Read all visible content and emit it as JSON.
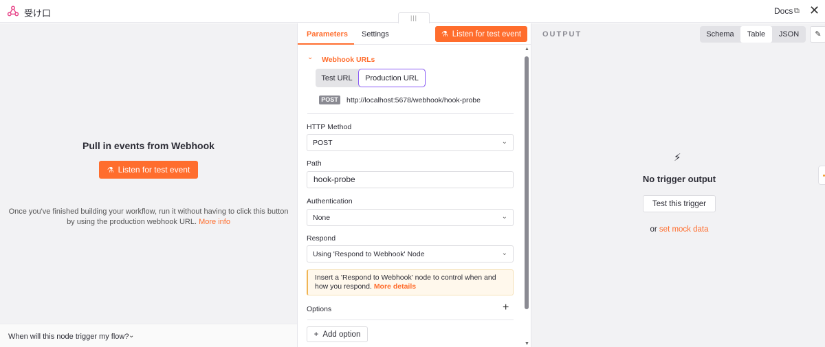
{
  "titlebar": {
    "title": "受け口",
    "docs_label": "Docs",
    "accent": "#ff6d2d"
  },
  "left_panel": {
    "heading": "Pull in events from Webhook",
    "listen_button": "Listen for test event",
    "note": "Once you've finished building your workflow, run it without having to click this button by using the production webhook URL.",
    "more_info": "More info",
    "footer_question": "When will this node trigger my flow?"
  },
  "params": {
    "tabs": [
      "Parameters",
      "Settings"
    ],
    "listen_button": "Listen for test event",
    "webhook_urls": {
      "title": "Webhook URLs",
      "options": [
        "Test URL",
        "Production URL"
      ],
      "selected": "Production URL",
      "method_badge": "POST",
      "url": "http://localhost:5678/webhook/hook-probe"
    },
    "http_method": {
      "label": "HTTP Method",
      "value": "POST"
    },
    "path": {
      "label": "Path",
      "value": "hook-probe"
    },
    "authentication": {
      "label": "Authentication",
      "value": "None"
    },
    "respond": {
      "label": "Respond",
      "value": "Using 'Respond to Webhook' Node"
    },
    "notice": {
      "text": "Insert a 'Respond to Webhook' node to control when and how you respond.",
      "link": "More details"
    },
    "options_label": "Options",
    "add_option": "Add option"
  },
  "output": {
    "label": "OUTPUT",
    "views": [
      "Schema",
      "Table",
      "JSON"
    ],
    "selected_view": "Table",
    "empty_title": "No trigger output",
    "test_button": "Test this trigger",
    "mock_prefix": "or",
    "mock_link": "set mock data"
  }
}
